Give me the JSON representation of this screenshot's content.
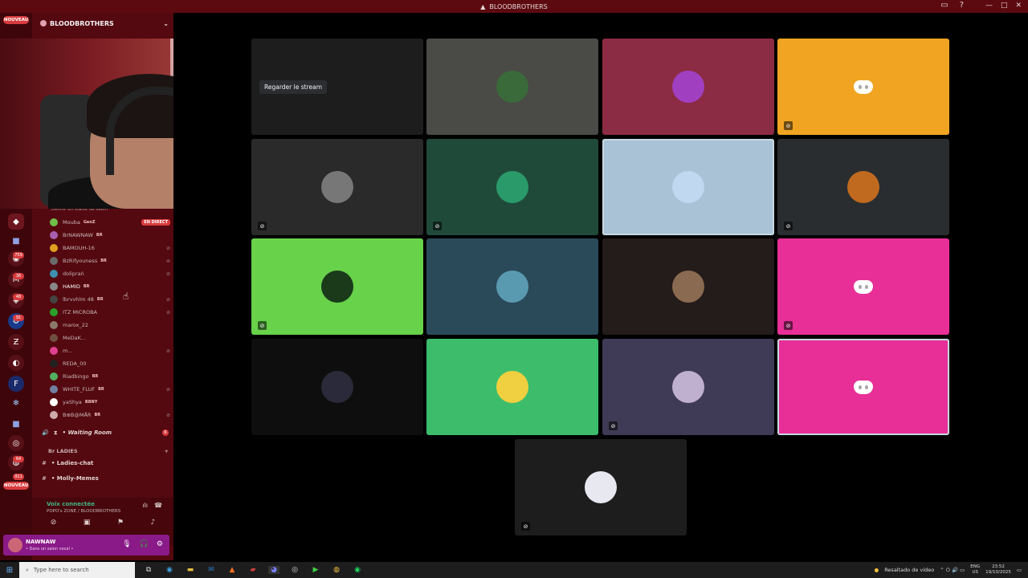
{
  "window": {
    "title": "BLOODBROTHERS"
  },
  "servers": {
    "new_badge": "NOUVEAU",
    "new_badge_bottom": "NOUVEAU",
    "counts": [
      "759",
      "36",
      "48",
      "91",
      "64",
      "911"
    ]
  },
  "sidebar": {
    "server_name": "BLOODBROTHERS",
    "status_placeholder": "Définir un statut de salon",
    "live_label": "EN DIRECT",
    "members": [
      {
        "name": "Mouba",
        "tag": "GenZ",
        "live": true,
        "color": "#6fbf4a"
      },
      {
        "name": "BrNAWNAW",
        "tag": "BR",
        "color": "#a85fb0"
      },
      {
        "name": "BAMOUH-16",
        "tag": "",
        "color": "#e0a020"
      },
      {
        "name": "BzRifyouness",
        "tag": "BR",
        "color": "#6a6a6a"
      },
      {
        "name": "doliprań",
        "tag": "",
        "color": "#3e8fb0"
      },
      {
        "name": "HAMID",
        "tag": "BR",
        "color": "#888",
        "active": true
      },
      {
        "name": "lbrvvhlm 48",
        "tag": "BR",
        "color": "#444"
      },
      {
        "name": "ITZ MICROBA",
        "tag": "",
        "color": "#2aa02a"
      },
      {
        "name": "marox_22",
        "tag": "",
        "color": "#8a7a6a"
      },
      {
        "name": "MeDaK...",
        "tag": "",
        "color": "#705040"
      },
      {
        "name": "m...",
        "tag": "",
        "color": "#e04090"
      },
      {
        "name": "REDA_00",
        "tag": "",
        "color": "#222"
      },
      {
        "name": "Riadbingo",
        "tag": "BR",
        "color": "#50b060"
      },
      {
        "name": "WHITE_FLUF",
        "tag": "BR",
        "color": "#7080a0"
      },
      {
        "name": "yaShya",
        "tag": "BBNY",
        "color": "#fff"
      },
      {
        "name": "B⊕B@MÅR",
        "tag": "BR",
        "color": "#caa"
      }
    ],
    "channels": {
      "waiting_room": "• Waiting Room",
      "waiting_unread": "6",
      "category_ladies": "Br LADIES",
      "ladies_chat": "• Ladies-chat",
      "molly_memes": "• Molly-Memes"
    },
    "voice": {
      "title": "Voix connectée",
      "subtitle": "POPO's ZONE / BLOODBROTHERS"
    },
    "user": {
      "name": "NAWNAW",
      "status": "• Dans un salon vocal •"
    }
  },
  "stage": {
    "watch_button": "Regarder le stream",
    "tiles": [
      {
        "bg": "#1d1d1d",
        "type": "stream"
      },
      {
        "bg": "#4a4a47",
        "type": "avatar",
        "avatar_color": "#3a6a3a",
        "avatar_icon": "jersey-avatar"
      },
      {
        "bg": "#8c2b44",
        "type": "avatar",
        "avatar_color": "#a040c0",
        "avatar_icon": "anime-avatar"
      },
      {
        "bg": "#f0a422",
        "type": "discord",
        "mute": true
      },
      {
        "bg": "#2a2a2a",
        "type": "avatar",
        "avatar_color": "#777",
        "avatar_icon": "car-avatar",
        "mute": true
      },
      {
        "bg": "#1f4a3a",
        "type": "avatar",
        "avatar_color": "#2a9a6a",
        "avatar_icon": "abstract-avatar",
        "mute": true
      },
      {
        "bg": "#a9c2d6",
        "type": "avatar",
        "avatar_color": "#c0d8f0",
        "avatar_icon": "sea-avatar",
        "speaking": true
      },
      {
        "bg": "#2a2d2f",
        "type": "avatar",
        "avatar_color": "#c06a20",
        "avatar_icon": "fire-avatar",
        "mute": true
      },
      {
        "bg": "#67d24a",
        "type": "avatar",
        "avatar_color": "#1a3a1a",
        "avatar_icon": "microba-avatar",
        "mute": true
      },
      {
        "bg": "#2a4a5a",
        "type": "avatar",
        "avatar_color": "#5a9ab0",
        "avatar_icon": "lightning-avatar"
      },
      {
        "bg": "#241c1a",
        "type": "avatar",
        "avatar_color": "#8a6a50",
        "avatar_icon": "photo-avatar"
      },
      {
        "bg": "#e82f97",
        "type": "discord",
        "mute": true
      },
      {
        "bg": "#0e0e0e",
        "type": "avatar",
        "avatar_color": "#2a2a3a",
        "avatar_icon": "dark-avatar"
      },
      {
        "bg": "#3dbc6c",
        "type": "avatar",
        "avatar_color": "#f0d040",
        "avatar_icon": "cartoon-avatar"
      },
      {
        "bg": "#3f3a55",
        "type": "avatar",
        "avatar_color": "#c0b0d0",
        "avatar_icon": "anime-girl-avatar",
        "mute": true
      },
      {
        "bg": "#e82f97",
        "type": "discord",
        "speaking": true
      },
      {
        "bg": "#1d1d1d",
        "type": "avatar",
        "avatar_color": "#e8e8f0",
        "avatar_icon": "bear-avatar",
        "mute": true
      }
    ]
  },
  "taskbar": {
    "search_placeholder": "Type here to search",
    "notif": "Resaltado de vídeo",
    "lang": "ENG",
    "region": "US",
    "time": "23:52",
    "date": "19/10/2025"
  }
}
